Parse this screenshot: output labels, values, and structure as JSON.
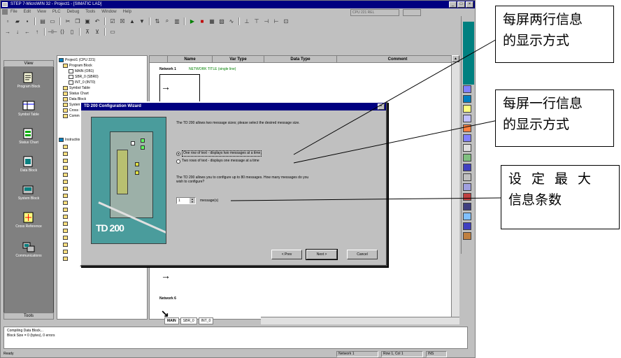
{
  "window": {
    "title": "STEP 7-MicroWIN 32 - Project1 - [SIMATIC LAD]",
    "min_label": "_",
    "max_label": "□",
    "close_label": "×"
  },
  "menu": [
    "File",
    "Edit",
    "View",
    "PLC",
    "Debug",
    "Tools",
    "Window",
    "Help"
  ],
  "cpu_box": "CPU 221 REL",
  "navigation": {
    "header": "View",
    "items": [
      "Program Block",
      "Symbol Table",
      "Status Chart",
      "Data Block",
      "System Block",
      "Cross Reference",
      "Communications"
    ],
    "footer": "Tools"
  },
  "tree": {
    "rows": [
      "Project1 (CPU 221)",
      "Program Block",
      "MAIN (OB1)",
      "SBR_0 (SBR0)",
      "INT_0 (INT0)",
      "Symbol Table",
      "Status Chart",
      "Data Block",
      "System Block",
      "Cross Reference",
      "Communications",
      "Instructions"
    ]
  },
  "editor": {
    "columns": [
      "",
      "Name",
      "Var Type",
      "Data Type",
      "Comment"
    ],
    "network1": "Network 1",
    "network1_comment": "NETWORK TITLE (single line)",
    "network6": "Network 6",
    "tabs": [
      "MAIN",
      "SBR_0",
      "INT_0"
    ]
  },
  "output": {
    "lines": [
      "Compiling Data Block...",
      "Block Size = 0 (bytes), 0 errors"
    ]
  },
  "status": {
    "ready": "Ready",
    "network": "Network 1",
    "position": "Row 1, Col 1",
    "mode": "INS"
  },
  "dialog": {
    "title": "TD 200 Configuration Wizard",
    "close_label": "×",
    "image_label": "TD 200",
    "intro": "The TD 200 allows two message sizes; please select the desired message size.",
    "option1": "One row of text - displays two messages at a time",
    "option2": "Two rows of text - displays one message at a time",
    "count_text": "The TD 200 allows you to configure up to 80 messages. How many messages do you wish to configure?",
    "spin_value": "1",
    "spin_label": "message(s)",
    "btn_prev": "< Prev",
    "btn_next": "Next >",
    "btn_cancel": "Cancel"
  },
  "annotations": {
    "c1_line1": "每屏两行信息",
    "c1_line2": "的显示方式",
    "c2_line1": "每屏一行信息",
    "c2_line2": "的显示方式",
    "c3_line1": "设定最大",
    "c3_line2": "信息条数"
  },
  "colors": {
    "titlebar": "#000080",
    "navbar": "#808080",
    "dialog_image": "#4a9c9c",
    "netcomment": "#008000"
  }
}
